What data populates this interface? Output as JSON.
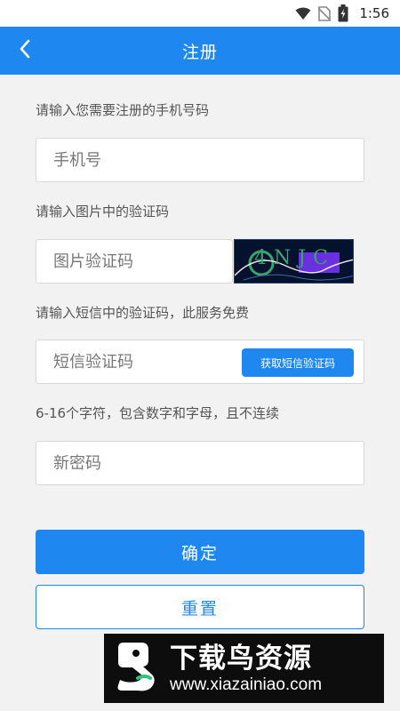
{
  "status_bar": {
    "time": "1:56",
    "icons": [
      "wifi-icon",
      "no-sim-icon",
      "battery-charging-icon"
    ]
  },
  "app_bar": {
    "title": "注册",
    "back_icon": "chevron-left-icon"
  },
  "form": {
    "phone_label": "请输入您需要注册的手机号码",
    "phone_placeholder": "手机号",
    "captcha_label": "请输入图片中的验证码",
    "captcha_placeholder": "图片验证码",
    "captcha_image_text": "4NJC",
    "sms_label": "请输入短信中的验证码，此服务免费",
    "sms_placeholder": "短信验证码",
    "sms_button": "获取短信验证码",
    "password_label": "6-16个字符，包含数字和字母，且不连续",
    "password_placeholder": "新密码"
  },
  "actions": {
    "confirm": "确定",
    "reset": "重置"
  },
  "watermark": {
    "title": "下载鸟资源",
    "url": "www.xiazainiao.com"
  },
  "colors": {
    "primary": "#1e88f0",
    "background": "#f2f2f2"
  }
}
